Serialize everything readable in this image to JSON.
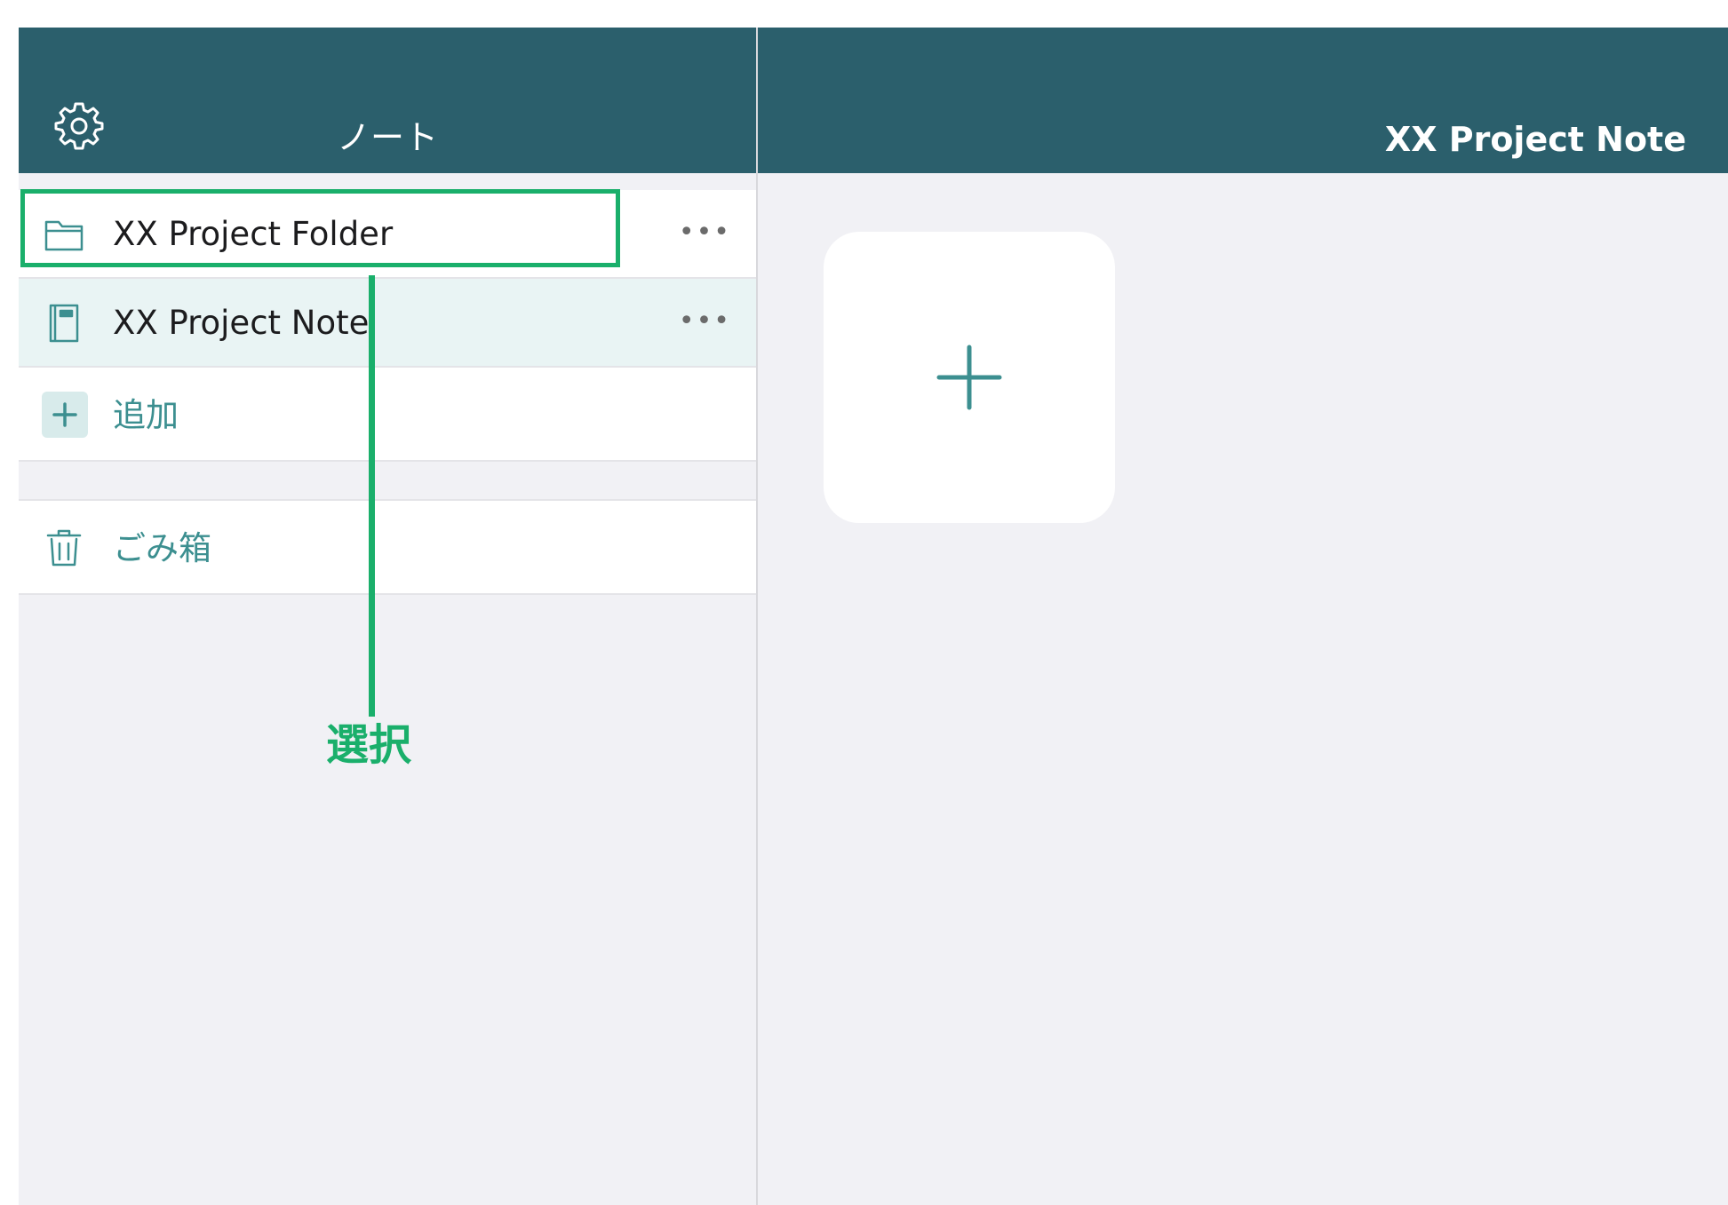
{
  "sidebar": {
    "title": "ノート",
    "items": [
      {
        "label": "XX Project Folder",
        "more": "•••",
        "icon": "folder-icon"
      },
      {
        "label": "XX Project Note",
        "more": "•••",
        "icon": "notebook-icon"
      }
    ],
    "add_label": "追加",
    "trash_label": "ごみ箱"
  },
  "main": {
    "title": "XX Project Note"
  },
  "callout": {
    "label": "選択"
  },
  "colors": {
    "header": "#2b5f6c",
    "accent": "#3c8f90",
    "highlight": "#1aaf6b",
    "background": "#f1f1f5"
  }
}
